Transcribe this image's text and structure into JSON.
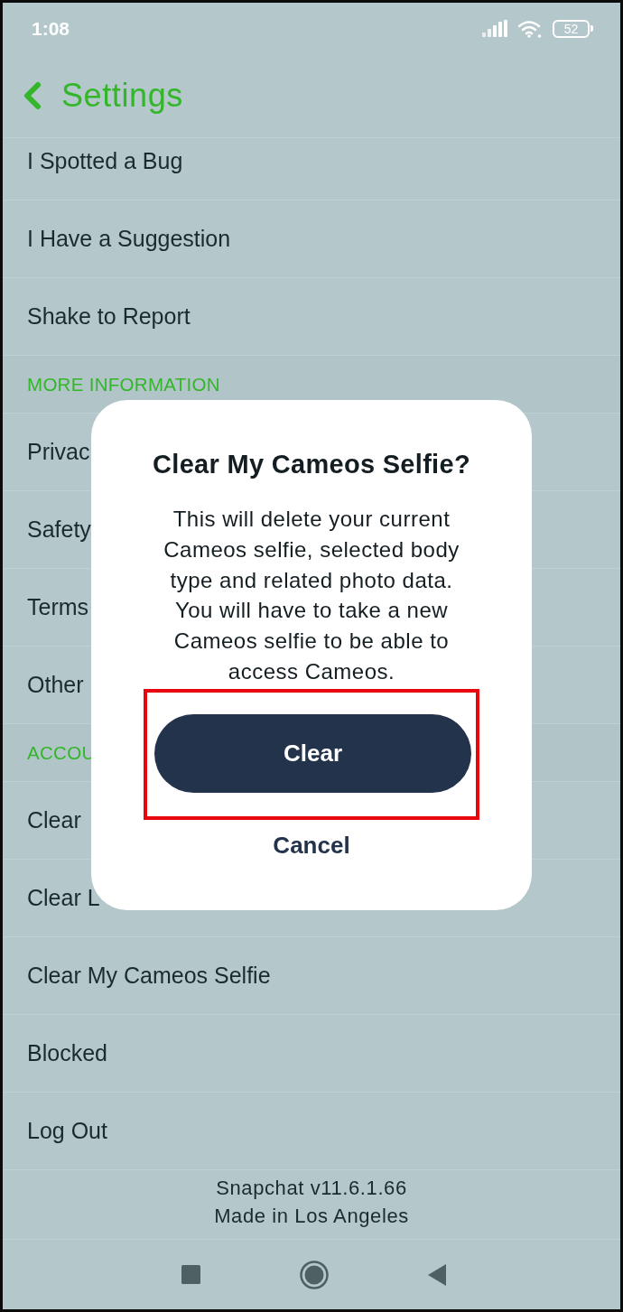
{
  "status_bar": {
    "time": "1:08",
    "battery": "52"
  },
  "header": {
    "title": "Settings"
  },
  "list": [
    {
      "kind": "item",
      "label": "I Spotted a Bug"
    },
    {
      "kind": "item",
      "label": "I Have a Suggestion"
    },
    {
      "kind": "item",
      "label": "Shake to Report"
    },
    {
      "kind": "section",
      "label": "MORE INFORMATION"
    },
    {
      "kind": "item",
      "label": "Privac"
    },
    {
      "kind": "item",
      "label": "Safety"
    },
    {
      "kind": "item",
      "label": "Terms"
    },
    {
      "kind": "item",
      "label": "Other"
    },
    {
      "kind": "section",
      "label": "ACCOU"
    },
    {
      "kind": "item",
      "label": "Clear"
    },
    {
      "kind": "item",
      "label": "Clear L"
    },
    {
      "kind": "item",
      "label": "Clear My Cameos Selfie"
    },
    {
      "kind": "item",
      "label": "Blocked"
    },
    {
      "kind": "item",
      "label": "Log Out"
    }
  ],
  "footer": {
    "lines": [
      "Snapchat v11.6.1.66",
      "Made in Los Angeles"
    ]
  },
  "dialog": {
    "title": "Clear My Cameos Selfie?",
    "message": "This will delete your current Cameos selfie, selected body type and related photo data. You will have to take a new Cameos selfie to be able to access Cameos.",
    "buttons": [
      {
        "kind": "primary",
        "label": "Clear",
        "highlighted": true
      },
      {
        "kind": "text",
        "label": "Cancel",
        "highlighted": false
      }
    ]
  }
}
